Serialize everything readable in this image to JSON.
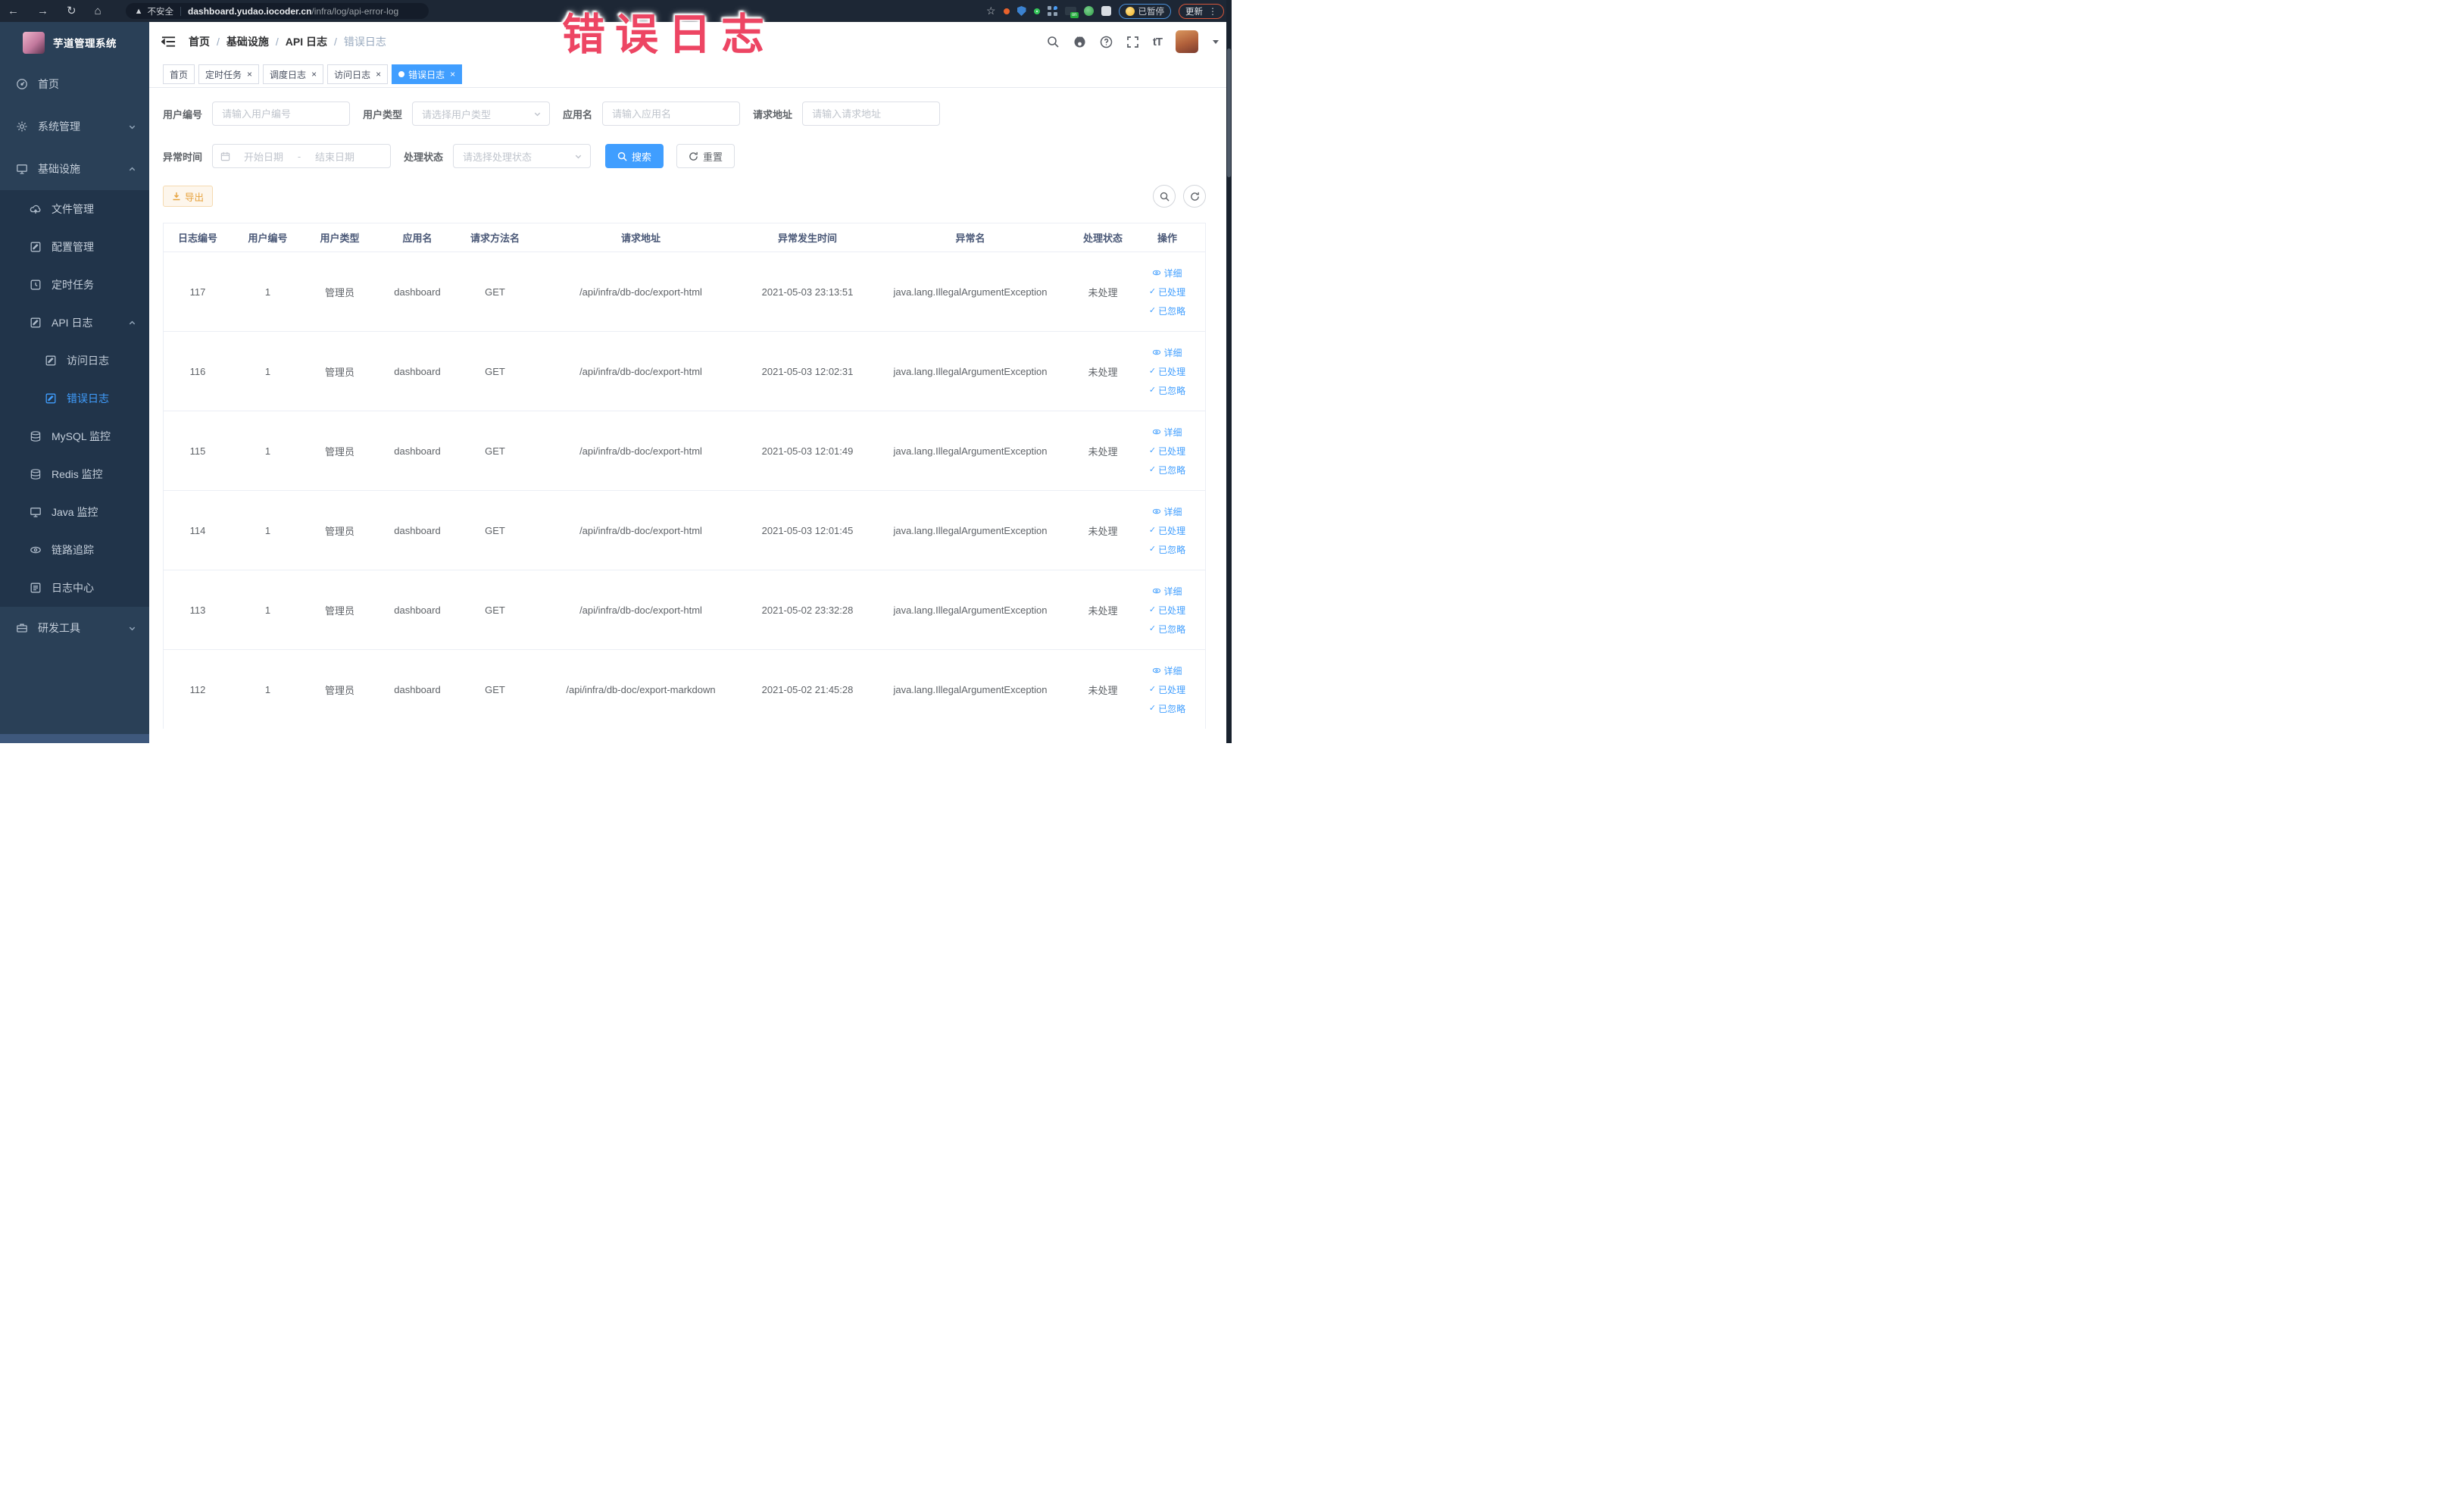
{
  "browser": {
    "security_label": "不安全",
    "url_domain": "dashboard.yudao.iocoder.cn",
    "url_path": "/infra/log/api-error-log",
    "paused_pill_label": "已暂停",
    "update_pill_label": "更新"
  },
  "annotation": {
    "text": "错误日志",
    "color": "#ed4563"
  },
  "colors": {
    "accent": "#409eff",
    "warning": "#e6a23c",
    "sidebar_active": "#409eff"
  },
  "sidebar": {
    "logo_title": "芋道管理系统",
    "items": [
      {
        "label": "首页",
        "name": "home",
        "icon": "gauge",
        "level": 1
      },
      {
        "label": "系统管理",
        "name": "system-management",
        "icon": "gear",
        "level": 1,
        "chevron": "down"
      },
      {
        "label": "基础设施",
        "name": "infrastructure",
        "icon": "monitor",
        "level": 1,
        "chevron": "up"
      },
      {
        "label": "文件管理",
        "name": "file-management",
        "icon": "cloud",
        "level": 2
      },
      {
        "label": "配置管理",
        "name": "config-management",
        "icon": "pen",
        "level": 2
      },
      {
        "label": "定时任务",
        "name": "scheduled-tasks",
        "icon": "clock",
        "level": 2
      },
      {
        "label": "API 日志",
        "name": "api-log",
        "icon": "pen",
        "level": 2,
        "chevron": "up"
      },
      {
        "label": "访问日志",
        "name": "access-log",
        "icon": "pen",
        "level": 3
      },
      {
        "label": "错误日志",
        "name": "error-log",
        "icon": "pen",
        "level": 3,
        "active": true
      },
      {
        "label": "MySQL 监控",
        "name": "mysql-monitor",
        "icon": "db",
        "level": 2
      },
      {
        "label": "Redis 监控",
        "name": "redis-monitor",
        "icon": "db",
        "level": 2
      },
      {
        "label": "Java 监控",
        "name": "java-monitor",
        "icon": "monitor",
        "level": 2
      },
      {
        "label": "链路追踪",
        "name": "trace",
        "icon": "eye",
        "level": 2
      },
      {
        "label": "日志中心",
        "name": "log-center",
        "icon": "note",
        "level": 2
      },
      {
        "label": "研发工具",
        "name": "dev-tools",
        "icon": "toolbox",
        "level": 1,
        "chevron": "down"
      }
    ]
  },
  "header": {
    "breadcrumb": [
      "首页",
      "基础设施",
      "API 日志",
      "错误日志"
    ]
  },
  "tabs": [
    {
      "label": "首页",
      "name": "tab-home",
      "closable": false,
      "active": false
    },
    {
      "label": "定时任务",
      "name": "tab-scheduled-tasks",
      "closable": true,
      "active": false
    },
    {
      "label": "调度日志",
      "name": "tab-schedule-log",
      "closable": true,
      "active": false
    },
    {
      "label": "访问日志",
      "name": "tab-access-log",
      "closable": true,
      "active": false
    },
    {
      "label": "错误日志",
      "name": "tab-error-log",
      "closable": true,
      "active": true
    }
  ],
  "filters": {
    "user_id": {
      "label": "用户编号",
      "placeholder": "请输入用户编号"
    },
    "user_type": {
      "label": "用户类型",
      "placeholder": "请选择用户类型"
    },
    "app_name": {
      "label": "应用名",
      "placeholder": "请输入应用名"
    },
    "request_url": {
      "label": "请求地址",
      "placeholder": "请输入请求地址"
    },
    "exception_time": {
      "label": "异常时间",
      "start_placeholder": "开始日期",
      "separator": "-",
      "end_placeholder": "结束日期"
    },
    "process_status": {
      "label": "处理状态",
      "placeholder": "请选择处理状态"
    },
    "search_button": "搜索",
    "reset_button": "重置"
  },
  "toolbar": {
    "export_button": "导出"
  },
  "table": {
    "headers": [
      "日志编号",
      "用户编号",
      "用户类型",
      "应用名",
      "请求方法名",
      "请求地址",
      "异常发生时间",
      "异常名",
      "处理状态",
      "操作"
    ],
    "actions": [
      {
        "label": "详细",
        "icon": "eye",
        "name": "detail-link"
      },
      {
        "label": "已处理",
        "icon": "check",
        "name": "processed-link"
      },
      {
        "label": "已忽略",
        "icon": "check",
        "name": "ignored-link"
      }
    ],
    "rows": [
      {
        "log_id": "117",
        "user_id": "1",
        "user_type": "管理员",
        "app": "dashboard",
        "method": "GET",
        "url": "/api/infra/db-doc/export-html",
        "time": "2021-05-03 23:13:51",
        "exception": "java.lang.IllegalArgumentException",
        "status": "未处理"
      },
      {
        "log_id": "116",
        "user_id": "1",
        "user_type": "管理员",
        "app": "dashboard",
        "method": "GET",
        "url": "/api/infra/db-doc/export-html",
        "time": "2021-05-03 12:02:31",
        "exception": "java.lang.IllegalArgumentException",
        "status": "未处理"
      },
      {
        "log_id": "115",
        "user_id": "1",
        "user_type": "管理员",
        "app": "dashboard",
        "method": "GET",
        "url": "/api/infra/db-doc/export-html",
        "time": "2021-05-03 12:01:49",
        "exception": "java.lang.IllegalArgumentException",
        "status": "未处理"
      },
      {
        "log_id": "114",
        "user_id": "1",
        "user_type": "管理员",
        "app": "dashboard",
        "method": "GET",
        "url": "/api/infra/db-doc/export-html",
        "time": "2021-05-03 12:01:45",
        "exception": "java.lang.IllegalArgumentException",
        "status": "未处理"
      },
      {
        "log_id": "113",
        "user_id": "1",
        "user_type": "管理员",
        "app": "dashboard",
        "method": "GET",
        "url": "/api/infra/db-doc/export-html",
        "time": "2021-05-02 23:32:28",
        "exception": "java.lang.IllegalArgumentException",
        "status": "未处理"
      },
      {
        "log_id": "112",
        "user_id": "1",
        "user_type": "管理员",
        "app": "dashboard",
        "method": "GET",
        "url": "/api/infra/db-doc/export-markdown",
        "time": "2021-05-02 21:45:28",
        "exception": "java.lang.IllegalArgumentException",
        "status": "未处理"
      }
    ]
  }
}
